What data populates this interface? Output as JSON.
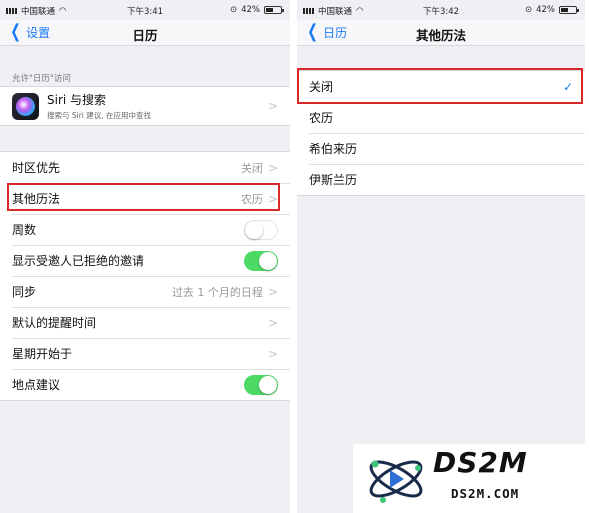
{
  "colors": {
    "accent": "#1a7af5",
    "toggle_on": "#4cd964",
    "highlight": "#d62a2a",
    "background": "#efeff4"
  },
  "left": {
    "status": {
      "carrier": "中国联通",
      "time": "下午3:41",
      "battery": "42%"
    },
    "nav": {
      "back_label": "设置",
      "title": "日历"
    },
    "section_header": "允许\"日历\"访问",
    "siri": {
      "title": "Siri 与搜索",
      "subtitle": "搜索与 Siri 建议, 在应用中查找",
      "icon": "siri-icon"
    },
    "rows": [
      {
        "label": "时区优先",
        "value": "关闭",
        "chevron": true
      },
      {
        "label": "其他历法",
        "value": "农历",
        "chevron": true
      },
      {
        "label": "周数",
        "toggle": false
      },
      {
        "label": "显示受邀人已拒绝的邀请",
        "toggle": true
      },
      {
        "label": "同步",
        "value": "过去 1 个月的日程",
        "chevron": true
      },
      {
        "label": "默认的提醒时间",
        "value": "",
        "chevron": true
      },
      {
        "label": "星期开始于",
        "value": "",
        "chevron": true
      },
      {
        "label": "地点建议",
        "toggle": true
      }
    ]
  },
  "right": {
    "status": {
      "carrier": "中国联通",
      "time": "下午3:42",
      "battery": "42%"
    },
    "nav": {
      "back_label": "日历",
      "title": "其他历法"
    },
    "options": [
      {
        "label": "关闭",
        "selected": true
      },
      {
        "label": "农历",
        "selected": false
      },
      {
        "label": "希伯来历",
        "selected": false
      },
      {
        "label": "伊斯兰历",
        "selected": false
      }
    ]
  },
  "watermark": {
    "brand": "DS2M",
    "url": "DS2M.COM"
  }
}
